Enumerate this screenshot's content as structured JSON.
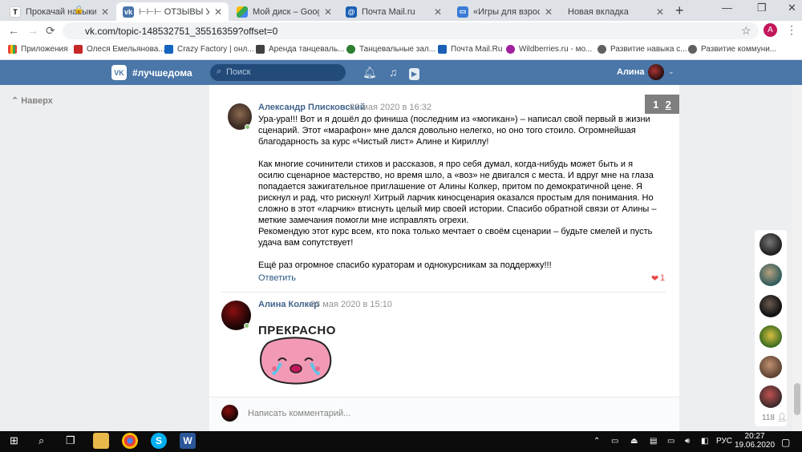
{
  "browser": {
    "tabs": [
      {
        "label": "Прокачай навыки ред",
        "icon": "T"
      },
      {
        "label": "⊢⊢⊢ ОТЗЫВЫ УЧАСТ",
        "icon": "vk"
      },
      {
        "label": "Мой диск – Google Ди",
        "icon": "drive"
      },
      {
        "label": "Почта Mail.ru",
        "icon": "mail"
      },
      {
        "label": "«Игры для взрослых»",
        "icon": "game"
      },
      {
        "label": "Новая вкладка",
        "icon": ""
      }
    ],
    "url": "vk.com/topic-148532751_35516359?offset=0",
    "profile_letter": "A",
    "bookmarks": [
      {
        "label": "Приложения"
      },
      {
        "label": "Олеся Емельянова..."
      },
      {
        "label": "Crazy Factory | онл..."
      },
      {
        "label": "Аренда танцеваль..."
      },
      {
        "label": "Танцевальные зал..."
      },
      {
        "label": "Почта Mail.Ru"
      },
      {
        "label": "Wildberries.ru - мо..."
      },
      {
        "label": "Развитие навыка с..."
      },
      {
        "label": "Развитие коммуни..."
      }
    ]
  },
  "vk": {
    "brand": "#лучшедома",
    "search_placeholder": "Поиск",
    "user_name": "Алина",
    "back_label": "Наверх",
    "pager": {
      "pages": [
        "1",
        "2"
      ],
      "current": "2"
    }
  },
  "comments": [
    {
      "author": "Александр Плисковский",
      "date": "22 мая 2020 в 16:32",
      "paragraphs": [
        "Ура-ура!!! Вот и я дошёл до финиша (последним из «могикан») – написал свой первый в жизни сценарий. Этот «марафон» мне дался довольно нелегко, но оно того стоило. Огромнейшая благодарность за курс «Чистый лист» Алине и Кириллу!",
        "Как многие сочинители стихов и рассказов, я про себя думал, когда-нибудь может быть и я осилю сценарное мастерство, но время шло, а «воз» не двигался с места. И вдруг мне на глаза попадается зажигательное приглашение от Алины Колкер, притом по демократичной цене. Я рискнул и рад, что рискнул! Хитрый ларчик киносценария оказался простым для понимания. Но сложно в этот «ларчик» втиснуть целый мир своей истории. Спасибо обратной связи от Алины – меткие замечания помогли мне исправлять огрехи.",
        "Рекомендую этот курс всем, кто пока только мечтает о своём сценарии – будьте смелей и пусть удача вам сопутствует!",
        "Ещё раз огромное спасибо кураторам и однокурсникам за поддержку!!!"
      ],
      "reply_label": "Ответить",
      "likes": "1"
    },
    {
      "author": "Алина Колкер",
      "date": "23 мая 2020 в 15:10",
      "sticker_text": "ПРЕКРАСНО"
    }
  ],
  "comment_box": {
    "placeholder": "Написать комментарий..."
  },
  "friends": {
    "count": "118"
  },
  "taskbar": {
    "lang": "РУС",
    "time": "20:27",
    "date": "19.06.2020"
  },
  "colors": {
    "vk_blue": "#4a76a8",
    "link": "#2a5885",
    "author": "#42648b",
    "like": "#e64646"
  }
}
